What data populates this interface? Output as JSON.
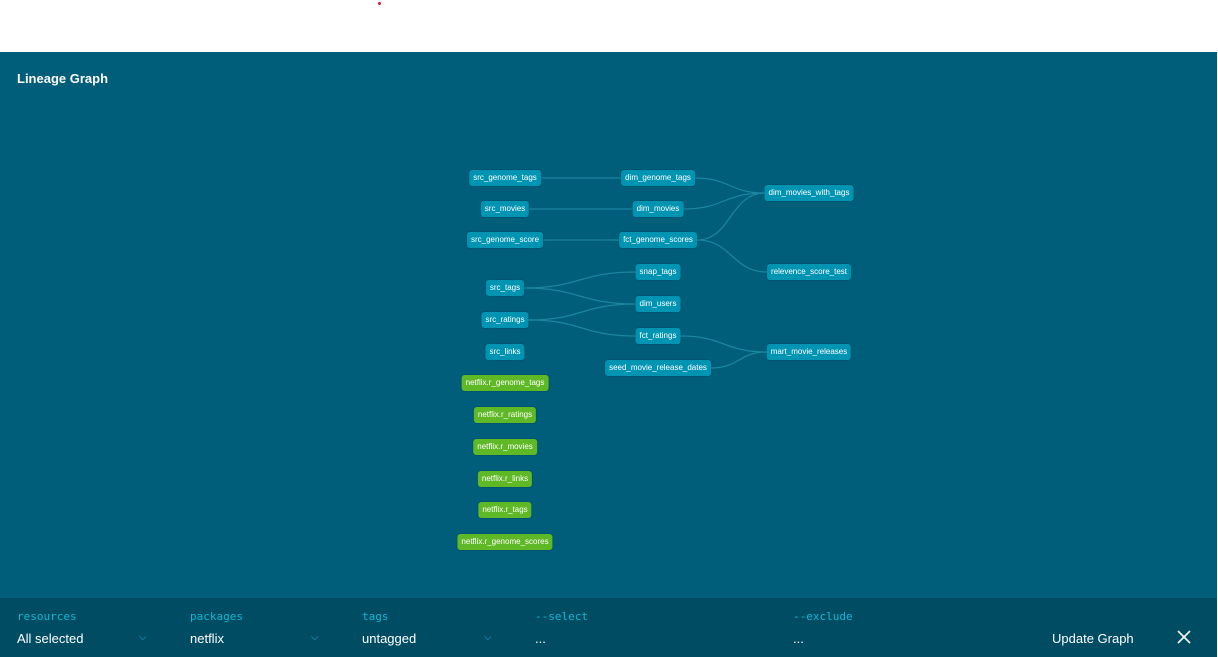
{
  "graph": {
    "title": "Lineage Graph",
    "model_color": "#0094b3",
    "source_color": "#5fb825",
    "nodes": [
      {
        "id": "src_genome_tags",
        "label": "src_genome_tags",
        "kind": "model"
      },
      {
        "id": "src_movies",
        "label": "src_movies",
        "kind": "model"
      },
      {
        "id": "src_genome_score",
        "label": "src_genome_score",
        "kind": "model"
      },
      {
        "id": "src_tags",
        "label": "src_tags",
        "kind": "model"
      },
      {
        "id": "src_ratings",
        "label": "src_ratings",
        "kind": "model"
      },
      {
        "id": "src_links",
        "label": "src_links",
        "kind": "model"
      },
      {
        "id": "r_genome_tags",
        "label": "netflix.r_genome_tags",
        "kind": "source"
      },
      {
        "id": "r_ratings",
        "label": "netflix.r_ratings",
        "kind": "source"
      },
      {
        "id": "r_movies",
        "label": "netflix.r_movies",
        "kind": "source"
      },
      {
        "id": "r_links",
        "label": "netflix.r_links",
        "kind": "source"
      },
      {
        "id": "r_tags",
        "label": "netflix.r_tags",
        "kind": "source"
      },
      {
        "id": "r_genome_scores",
        "label": "netflix.r_genome_scores",
        "kind": "source"
      },
      {
        "id": "dim_genome_tags",
        "label": "dim_genome_tags",
        "kind": "model"
      },
      {
        "id": "dim_movies",
        "label": "dim_movies",
        "kind": "model"
      },
      {
        "id": "fct_genome_scores",
        "label": "fct_genome_scores",
        "kind": "model"
      },
      {
        "id": "snap_tags",
        "label": "snap_tags",
        "kind": "model"
      },
      {
        "id": "dim_users",
        "label": "dim_users",
        "kind": "model"
      },
      {
        "id": "fct_ratings",
        "label": "fct_ratings",
        "kind": "model"
      },
      {
        "id": "seed_movie_release_dates",
        "label": "seed_movie_release_dates",
        "kind": "model"
      },
      {
        "id": "dim_movies_with_tags",
        "label": "dim_movies_with_tags",
        "kind": "model"
      },
      {
        "id": "relevence_score_test",
        "label": "relevence_score_test",
        "kind": "model"
      },
      {
        "id": "mart_movie_releases",
        "label": "mart_movie_releases",
        "kind": "model"
      }
    ],
    "edges": [
      [
        "src_genome_tags",
        "dim_genome_tags"
      ],
      [
        "src_movies",
        "dim_movies"
      ],
      [
        "src_genome_score",
        "fct_genome_scores"
      ],
      [
        "src_tags",
        "snap_tags"
      ],
      [
        "src_tags",
        "dim_users"
      ],
      [
        "src_ratings",
        "dim_users"
      ],
      [
        "src_ratings",
        "fct_ratings"
      ],
      [
        "dim_genome_tags",
        "dim_movies_with_tags"
      ],
      [
        "dim_movies",
        "dim_movies_with_tags"
      ],
      [
        "fct_genome_scores",
        "dim_movies_with_tags"
      ],
      [
        "fct_genome_scores",
        "relevence_score_test"
      ],
      [
        "fct_ratings",
        "mart_movie_releases"
      ],
      [
        "seed_movie_release_dates",
        "mart_movie_releases"
      ]
    ]
  },
  "controls": {
    "resources": {
      "label": "resources",
      "value": "All selected"
    },
    "packages": {
      "label": "packages",
      "value": "netflix"
    },
    "tags": {
      "label": "tags",
      "value": "untagged"
    },
    "select": {
      "label": "--select",
      "value": "..."
    },
    "exclude": {
      "label": "--exclude",
      "value": "..."
    },
    "update_label": "Update Graph",
    "accent": "#13b6d6"
  }
}
